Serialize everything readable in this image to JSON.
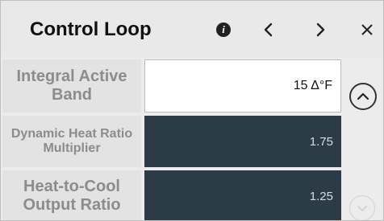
{
  "header": {
    "title": "Control Loop"
  },
  "rows": [
    {
      "label": "Integral Active Band",
      "value": "15 Δ°F"
    },
    {
      "label": "Dynamic Heat Ratio Multiplier",
      "value": "1.75"
    },
    {
      "label": "Heat-to-Cool Output Ratio",
      "value": "1.25"
    }
  ],
  "icons": {
    "info": "info-icon",
    "prev": "chevron-left-icon",
    "next": "chevron-right-icon",
    "close": "close-icon",
    "scroll_up": "chevron-up-icon",
    "scroll_down": "chevron-down-icon"
  },
  "colors": {
    "header_bg": "#e9e9e9",
    "dark_field": "#2c3c47",
    "label_text": "#8c8c8c"
  }
}
